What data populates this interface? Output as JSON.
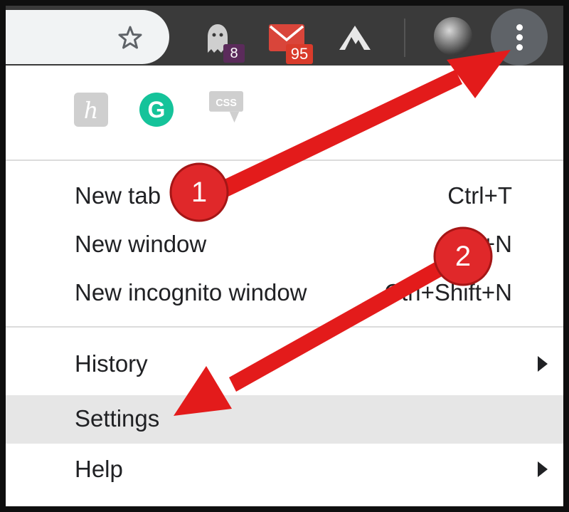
{
  "toolbar": {
    "extensions": [
      {
        "name": "ghostery",
        "icon": "ghost-icon",
        "badge": "8"
      },
      {
        "name": "gmail",
        "icon": "mail-icon",
        "badge": "95"
      },
      {
        "name": "vpn",
        "icon": "mountain-icon"
      }
    ],
    "menu_button_icon": "three-dot-vertical-icon"
  },
  "extension_row": [
    {
      "icon": "h-letter-icon",
      "label": "h"
    },
    {
      "icon": "grammarly-icon",
      "label": "G"
    },
    {
      "icon": "css-icon",
      "label": "CSS"
    }
  ],
  "menu": {
    "items": [
      {
        "label": "New tab",
        "shortcut": "Ctrl+T"
      },
      {
        "label": "New window",
        "shortcut": "Ctrl+N"
      },
      {
        "label": "New incognito window",
        "shortcut": "Ctrl+Shift+N"
      },
      {
        "label": "History"
      },
      {
        "label": "Settings"
      },
      {
        "label": "Help"
      }
    ]
  },
  "annotations": {
    "step1": "1",
    "step2": "2",
    "arrow_color": "#e31b1b"
  },
  "colors": {
    "toolbar_bg": "#3a3a3a",
    "menu_bg": "#ffffff",
    "highlight_bg": "#e6e6e6",
    "menu_button_bg": "#5f6368"
  }
}
